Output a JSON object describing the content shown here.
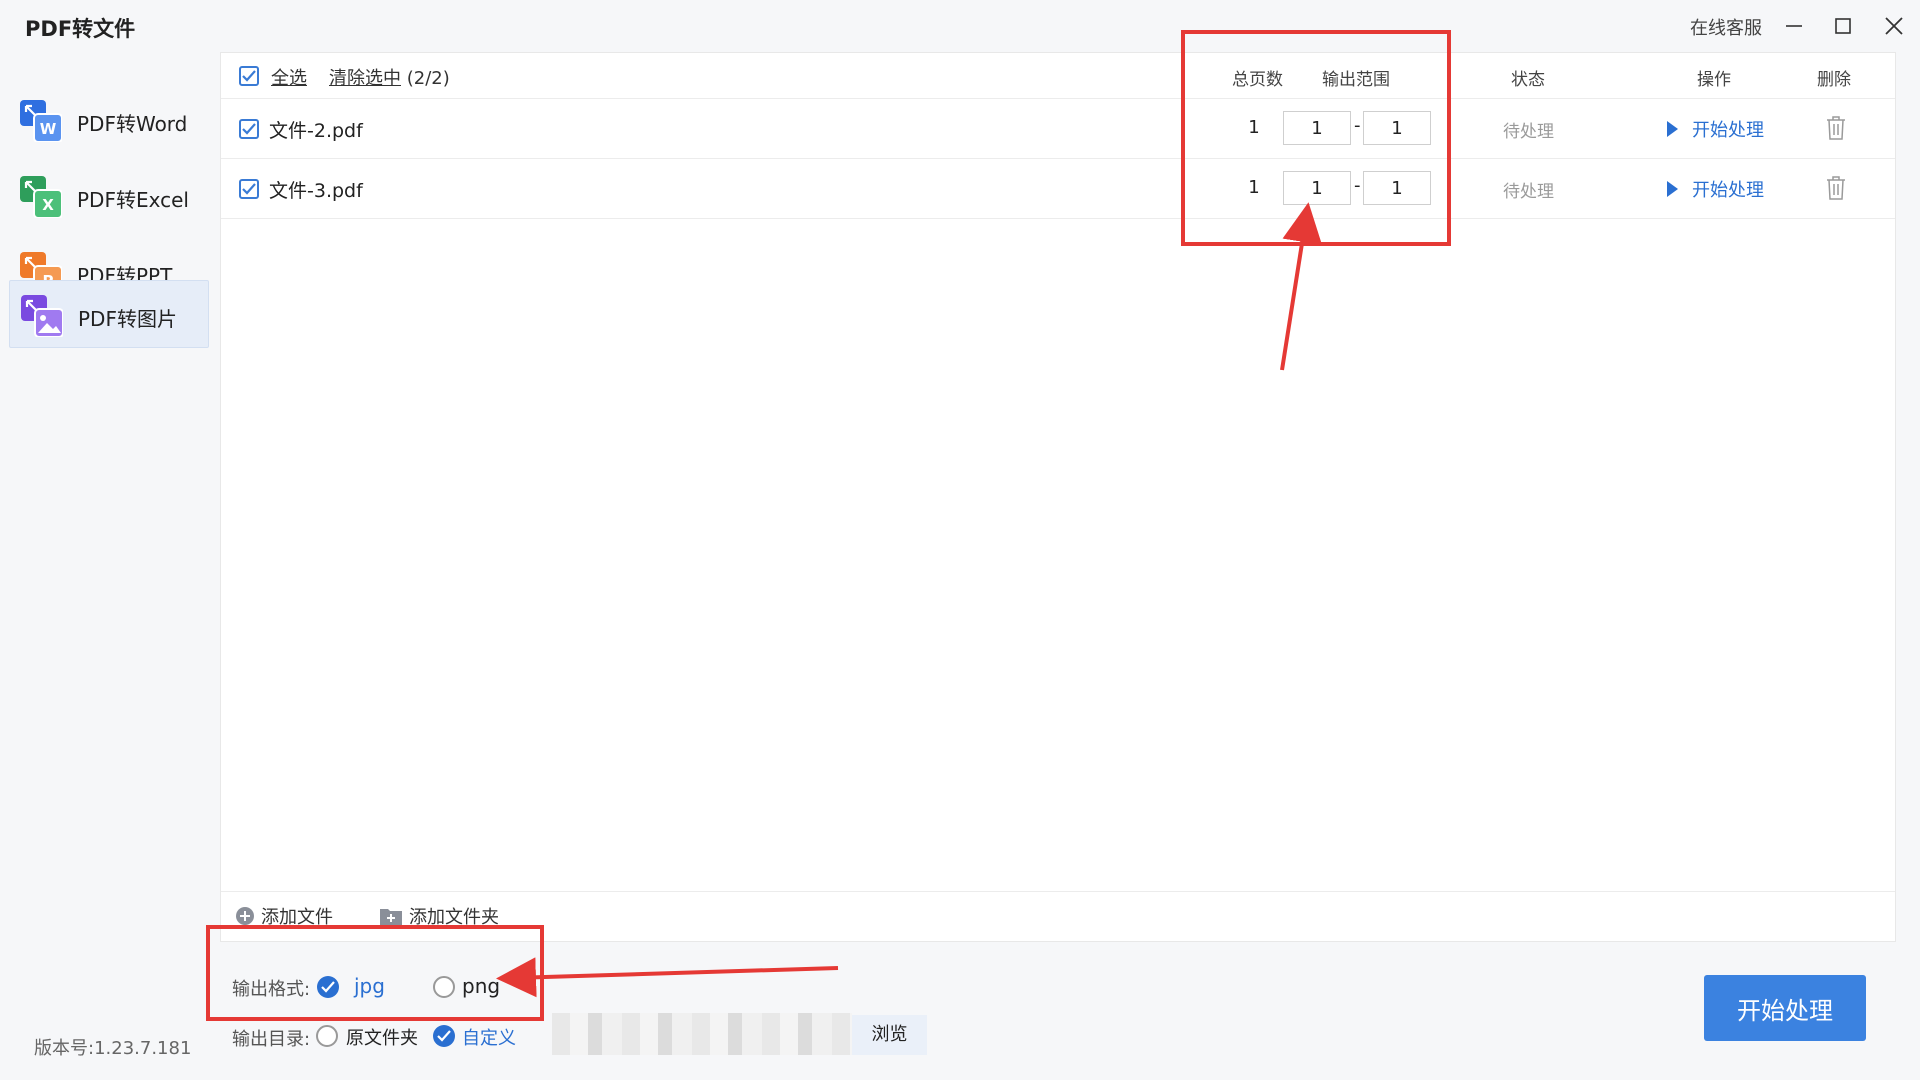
{
  "app": {
    "title": "PDF转文件",
    "online_service": "在线客服",
    "version": "版本号:1.23.7.181"
  },
  "sidebar": {
    "items": [
      {
        "label": "PDF转Word",
        "badge": "W",
        "color": "#2f6fe0",
        "active": false
      },
      {
        "label": "PDF转Excel",
        "badge": "X",
        "color": "#2e9e5b",
        "active": false
      },
      {
        "label": "PDF转PPT",
        "badge": "P",
        "color": "#ef7a2a",
        "active": false
      },
      {
        "label": "PDF转图片",
        "badge": "",
        "color": "#7a4ae0",
        "active": true
      }
    ]
  },
  "table": {
    "select_all": "全选",
    "clear_selected": "清除选中",
    "count": "(2/2)",
    "headers": {
      "pages": "总页数",
      "range": "输出范围",
      "status": "状态",
      "action": "操作",
      "delete": "删除"
    },
    "rows": [
      {
        "name": "文件-2.pdf",
        "pages": "1",
        "from": "1",
        "to": "1",
        "status": "待处理",
        "action": "开始处理"
      },
      {
        "name": "文件-3.pdf",
        "pages": "1",
        "from": "1",
        "to": "1",
        "status": "待处理",
        "action": "开始处理"
      }
    ]
  },
  "add": {
    "file": "添加文件",
    "folder": "添加文件夹"
  },
  "settings": {
    "format_label": "输出格式:",
    "format_options": [
      "jpg",
      "png"
    ],
    "format_selected": "jpg",
    "dir_label": "输出目录:",
    "dir_options": [
      "原文件夹",
      "自定义"
    ],
    "dir_selected": "自定义",
    "browse": "浏览",
    "start": "开始处理"
  },
  "range_dash": "-",
  "colors": {
    "accent": "#2a6fd1",
    "annotation": "#e53935",
    "primary_button": "#3b82e0"
  }
}
